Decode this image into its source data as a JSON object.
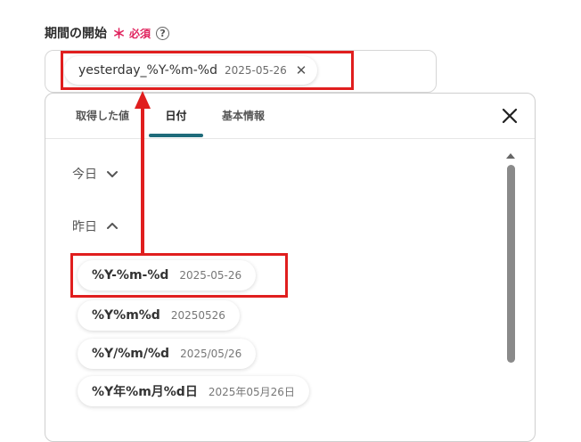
{
  "field": {
    "label": "期間の開始",
    "required_star": "＊",
    "required_text": "必須",
    "help_icon": "question-circle-icon"
  },
  "input_chip": {
    "value": "yesterday_%Y-%m-%d",
    "preview": "2025-05-26",
    "remove_icon": "close-icon"
  },
  "tabs": [
    {
      "label": "取得した値",
      "active": false
    },
    {
      "label": "日付",
      "active": true
    },
    {
      "label": "基本情報",
      "active": false
    }
  ],
  "accent_color": "#1f6b7a",
  "highlight_color": "#e01e1e",
  "groups": {
    "today": {
      "label": "今日",
      "expanded": false,
      "icon": "chevron-down-icon"
    },
    "yesterday": {
      "label": "昨日",
      "expanded": true,
      "icon": "chevron-up-icon"
    }
  },
  "options": [
    {
      "format": "%Y-%m-%d",
      "preview": "2025-05-26"
    },
    {
      "format": "%Y%m%d",
      "preview": "20250526"
    },
    {
      "format": "%Y/%m/%d",
      "preview": "2025/05/26"
    },
    {
      "format": "%Y年%m月%d日",
      "preview": "2025年05月26日"
    }
  ]
}
